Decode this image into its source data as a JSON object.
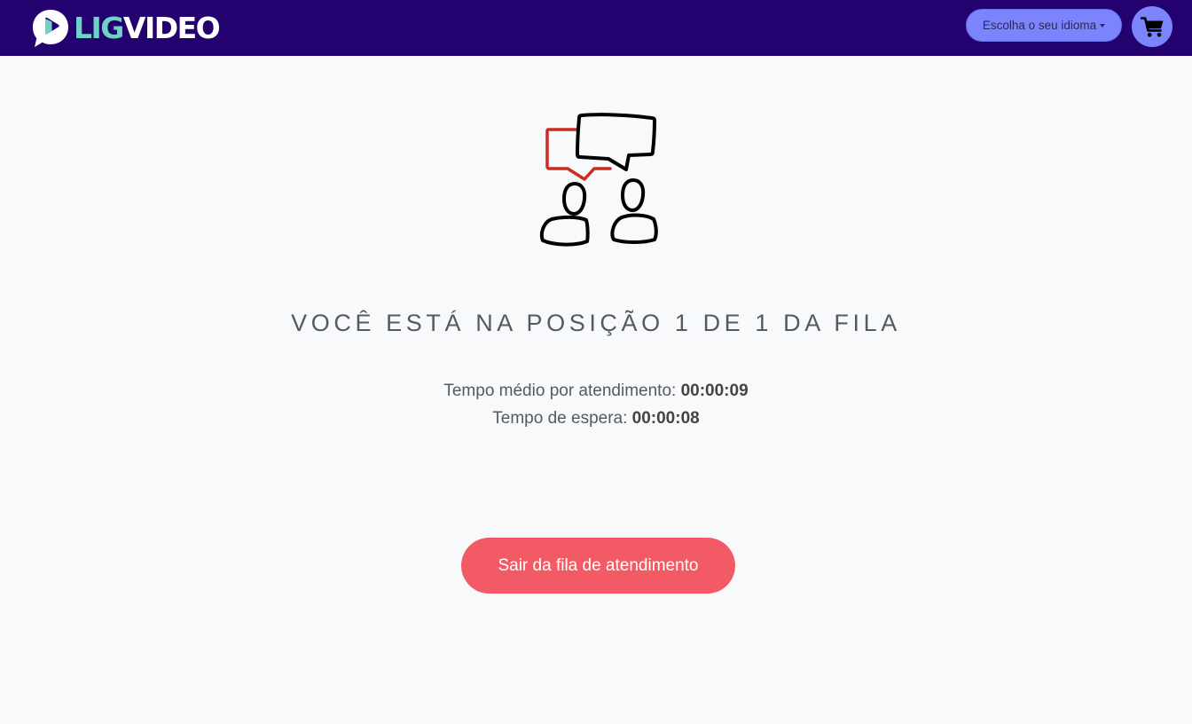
{
  "header": {
    "logo_part1": "LIG",
    "logo_part2": "VIDEO",
    "language_button_label": "Escolha o seu idioma",
    "cart_icon": "shopping-cart-icon"
  },
  "main": {
    "illustration_icon": "people-chatting-icon",
    "queue_title": "VOCÊ ESTÁ NA POSIÇÃO 1 DE 1 DA FILA",
    "avg_time_label": "Tempo médio por atendimento:",
    "avg_time_value": "00:00:09",
    "wait_time_label": "Tempo de espera:",
    "wait_time_value": "00:00:08",
    "leave_button_label": "Sair da fila de atendimento"
  },
  "colors": {
    "header_bg": "#23016f",
    "accent_button": "#7b84fc",
    "logo_lig": "#6cd3c6",
    "leave_button": "#f25b65",
    "chat_bubble_red": "#cc2a22"
  }
}
